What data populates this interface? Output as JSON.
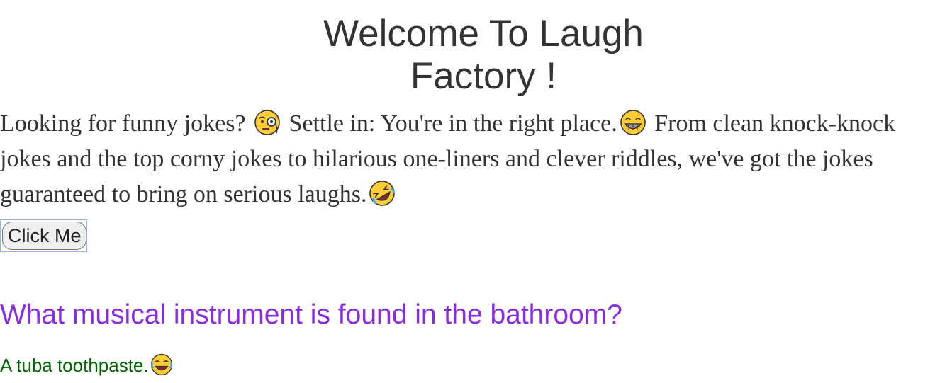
{
  "header": {
    "title_line1": "Welcome To Laugh",
    "title_line2": "Factory !"
  },
  "intro": {
    "segment1": "Looking for funny jokes?",
    "segment2": "Settle in: You're in the right place.",
    "segment3": "From clean knock-knock",
    "line2": "jokes and the top corny jokes to hilarious one-liners and clever riddles, we've got the jokes",
    "line3": "guaranteed to bring on serious laughs.",
    "emojis": [
      "monocle-face-emoji",
      "grinning-face-emoji",
      "rolling-on-floor-laughing-emoji"
    ]
  },
  "button": {
    "label": "Click Me"
  },
  "joke": {
    "question": "What musical instrument is found in the bathroom?",
    "answer": "A tuba toothpaste.",
    "answer_emoji": "tears-of-joy-emoji"
  },
  "colors": {
    "title": "#333333",
    "question": "#8a2be2",
    "answer": "#006400",
    "emoji_face": "#ffcc33"
  }
}
